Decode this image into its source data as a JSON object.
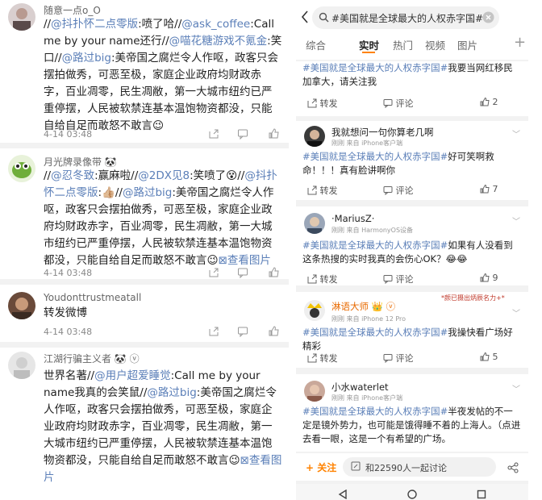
{
  "left": {
    "comments": [
      {
        "name": "随意一点o_O",
        "segments": [
          {
            "t": "//",
            "c": "n"
          },
          {
            "t": "@抖扑怀二点零版",
            "c": "l"
          },
          {
            "t": ":喷了哈//",
            "c": "n"
          },
          {
            "t": "@ask_coffee",
            "c": "l"
          },
          {
            "t": ":Call me by your name还行//",
            "c": "n"
          },
          {
            "t": "@喵花糖游戏不氪金",
            "c": "l"
          },
          {
            "t": ":笑口//",
            "c": "n"
          },
          {
            "t": "@路过big",
            "c": "l"
          },
          {
            "t": ":美帝国之腐烂令人作呕，政客只会摆拍做秀，可恶至极，家庭企业政府均财政赤字，百业凋零，民生凋敝，第一大城市纽约已严重停摆，人民被软禁连基本温饱物资都没，只能自给自足而敢怒不敢言",
            "c": "n"
          },
          {
            "t": "😉",
            "c": "n"
          }
        ],
        "time": "4-14 03:48"
      },
      {
        "name": "月光牌录像带 🐼",
        "segments": [
          {
            "t": "//",
            "c": "n"
          },
          {
            "t": "@忍冬致",
            "c": "l"
          },
          {
            "t": ":赢麻啦//",
            "c": "n"
          },
          {
            "t": "@2DX见8",
            "c": "l"
          },
          {
            "t": ":笑喷了😵//",
            "c": "n"
          },
          {
            "t": "@抖扑怀二点零版",
            "c": "l"
          },
          {
            "t": ":👍🏼//",
            "c": "n"
          },
          {
            "t": "@路过big",
            "c": "l"
          },
          {
            "t": ":美帝国之腐烂令人作呕，政客只会摆拍做秀，可恶至极，家庭企业政府均财政赤字，百业凋零，民生凋敝，第一大城市纽约已严重停摆，人民被软禁连基本温饱物资都没，只能自给自足而敢怒不敢言",
            "c": "n"
          },
          {
            "t": "😉",
            "c": "n"
          },
          {
            "t": "⊠查看图片",
            "c": "l"
          }
        ],
        "time": "4-14 03:48"
      },
      {
        "name": "Youdonttrustmeatall",
        "segments": [
          {
            "t": "转发微博",
            "c": "n"
          }
        ],
        "time": "4-14 03:48"
      },
      {
        "name": "江湖行骗主义者 🐼 ⓥ",
        "segments": [
          {
            "t": "世界名著//",
            "c": "n"
          },
          {
            "t": "@用户超爱睡觉",
            "c": "l"
          },
          {
            "t": ":Call me by your name我真的会笑鼠//",
            "c": "n"
          },
          {
            "t": "@路过big",
            "c": "l"
          },
          {
            "t": ":美帝国之腐烂令人作呕，政客只会摆拍做秀，可恶至极，家庭企业政府均财政赤字，百业凋零，民生凋敝，第一大城市纽约已严重停摆，人民被软禁连基本温饱物资都没，只能自给自足而敢怒不敢言",
            "c": "n"
          },
          {
            "t": "😉",
            "c": "n"
          },
          {
            "t": "⊠查看图片",
            "c": "l"
          }
        ],
        "time": "4-14 03:48"
      }
    ]
  },
  "right": {
    "search_query": "#美国就是全球最大的人权赤字国#",
    "tabs": [
      "综合",
      "实时",
      "热门",
      "视频",
      "图片"
    ],
    "active_tab": "实时",
    "repost_label": "转发",
    "comment_label": "评论",
    "posts": [
      {
        "name": "",
        "meta": "",
        "text_link": "#美国就是全球最大的人权赤字国#",
        "text": "我要当网红移民加拿大，请关注我",
        "likes": "2"
      },
      {
        "name": "我就想问一句你算老几啊",
        "meta": "刚刚  来自 iPhone客户端",
        "text_link": "#美国就是全球最大的人权赤字国#",
        "text": "好可笑啊救命！！！真有脸讲啊你",
        "likes": "7"
      },
      {
        "name": "·MariusZ·",
        "meta": "刚刚  来自 HarmonyOS设备",
        "text_link": "#美国就是全球最大的人权赤字国#",
        "text": "如果有人没看到这条热搜的实时我真的会伤心OK？😂😂",
        "likes": "9"
      },
      {
        "name": "淋语大师 👑 ⓥ",
        "meta": "刚刚  来自 iPhone 12 Pro",
        "text_link": "#美国就是全球最大的人权赤字国#",
        "text": "我操快看广场好精彩",
        "likes": "5",
        "badge": "*颜已摄出炳辰名力+*"
      },
      {
        "name": "小水waterlet",
        "meta": "刚刚  来自 iPhone客户端",
        "text_link": "#美国就是全球最大的人权赤字国#",
        "text": "半夜发帖的不一定是镜外势力，也可能是饿得睡不着的上海人。（点进去看一眼，这是一个有希望的广场。",
        "likes": ""
      }
    ],
    "bottom": {
      "follow_label": "+ 关注",
      "discuss_label": "和22590人一起讨论"
    },
    "colors": {
      "accent": "#ff8200",
      "link": "#5b7fb8"
    }
  }
}
